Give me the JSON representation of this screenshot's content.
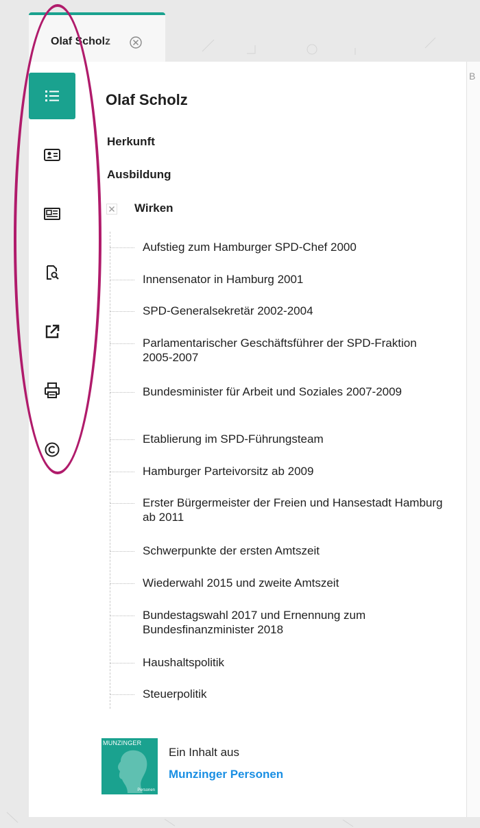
{
  "tab": {
    "label": "Olaf Scholz"
  },
  "article": {
    "title": "Olaf Scholz",
    "sections": [
      {
        "label": "Herkunft"
      },
      {
        "label": "Ausbildung"
      },
      {
        "label": "Wirken"
      }
    ],
    "wirken_items": [
      "Aufstieg zum Hamburger SPD-Chef 2000",
      "Innensenator in Hamburg 2001",
      "SPD-Generalsekretär 2002-2004",
      "Parlamentarischer Geschäftsführer der SPD-Fraktion 2005-2007",
      "Bundesminister für Arbeit und Soziales 2007-2009",
      "Etablierung im SPD-Führungsteam",
      "Hamburger Parteivorsitz ab 2009",
      "Erster Bürgermeister der Freien und Hansestadt Hamburg ab 2011",
      "Schwerpunkte der ersten Amtszeit",
      "Wiederwahl 2015 und zweite Amtszeit",
      "Bundestagswahl 2017 und Ernennung zum Bundesfinanzminister 2018",
      "Haushaltspolitik",
      "Steuerpolitik"
    ]
  },
  "sidebar": {
    "buttons": [
      {
        "icon": "table-of-contents-icon",
        "active": true
      },
      {
        "icon": "person-card-icon",
        "active": false
      },
      {
        "icon": "newspaper-icon",
        "active": false
      },
      {
        "icon": "document-search-icon",
        "active": false
      },
      {
        "icon": "external-link-icon",
        "active": false
      },
      {
        "icon": "printer-icon",
        "active": false
      },
      {
        "icon": "copyright-icon",
        "active": false
      }
    ]
  },
  "logo": {
    "word": "MUNZINGER",
    "sub": "Personen"
  },
  "footer": {
    "line1": "Ein Inhalt aus",
    "link": "Munzinger Personen"
  },
  "colors": {
    "accent": "#1aa28f",
    "link": "#1a8fe3",
    "annotation": "#b01b6b"
  }
}
